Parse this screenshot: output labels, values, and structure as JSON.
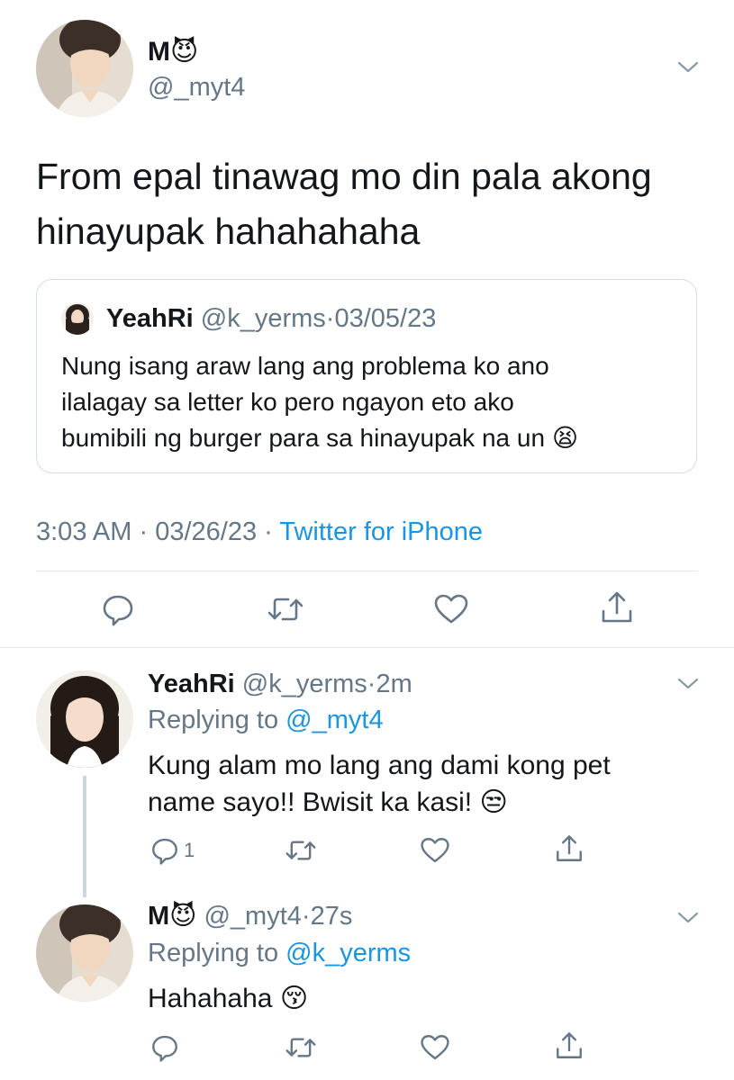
{
  "main_tweet": {
    "author": {
      "display_name": "M",
      "name_emoji": "😈",
      "handle": "@_myt4"
    },
    "text_line1": "From epal tinawag mo din pala akong",
    "text_line2": "hinayupak hahahahaha",
    "quoted": {
      "display_name": "YeahRi",
      "handle": "@k_yerms",
      "separator": "·",
      "date": "03/05/23",
      "line1": "Nung isang araw lang ang problema ko ano",
      "line2": "ilalagay sa letter ko pero ngayon eto ako",
      "line3": "bumibili ng burger para sa hinayupak na un",
      "emoji": "😫"
    },
    "meta": {
      "time": "3:03 AM",
      "separator1": "·",
      "date": "03/26/23",
      "separator2": "·",
      "source": "Twitter for iPhone"
    }
  },
  "replies": [
    {
      "display_name": "YeahRi",
      "name_emoji": "",
      "handle": "@k_yerms",
      "separator": "·",
      "age": "2m",
      "replying_prefix": "Replying to",
      "replying_to": "@_myt4",
      "line1": "Kung alam mo lang ang dami kong pet",
      "line2": "name sayo!! Bwisit ka kasi!",
      "emoji": "😒",
      "reply_count": "1"
    },
    {
      "display_name": "M",
      "name_emoji": "😈",
      "handle": "@_myt4",
      "separator": "·",
      "age": "27s",
      "replying_prefix": "Replying to",
      "replying_to": "@k_yerms",
      "line1": "Hahahaha",
      "emoji": "😚",
      "reply_count": ""
    }
  ],
  "colors": {
    "text": "#14171a",
    "secondary": "#657786",
    "link": "#1b95e0",
    "border": "#e1e8ed"
  },
  "icons": [
    "chevron-down-icon",
    "reply-icon",
    "retweet-icon",
    "like-icon",
    "share-icon",
    "devil-emoji",
    "tired-face-emoji",
    "unamused-emoji",
    "kissing-emoji"
  ]
}
